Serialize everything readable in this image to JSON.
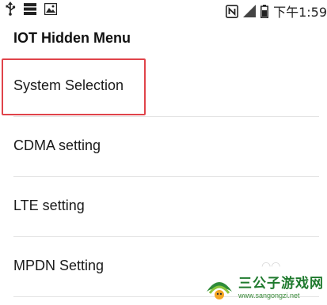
{
  "status_bar": {
    "left_icons": [
      "usb-icon",
      "storage-icon",
      "image-icon"
    ],
    "right_icons": [
      "nfc-icon",
      "signal-icon",
      "battery-icon"
    ],
    "time": "下午1:59"
  },
  "app_title": "IOT Hidden Menu",
  "menu": {
    "items": [
      {
        "label": "System Selection"
      },
      {
        "label": "CDMA setting"
      },
      {
        "label": "LTE setting"
      },
      {
        "label": "MPDN Setting"
      }
    ]
  },
  "highlight": {
    "color": "#e0434a",
    "target": "System Selection"
  },
  "watermark": {
    "title": "三公子游戏网",
    "url": "www.sangongzi.net"
  }
}
